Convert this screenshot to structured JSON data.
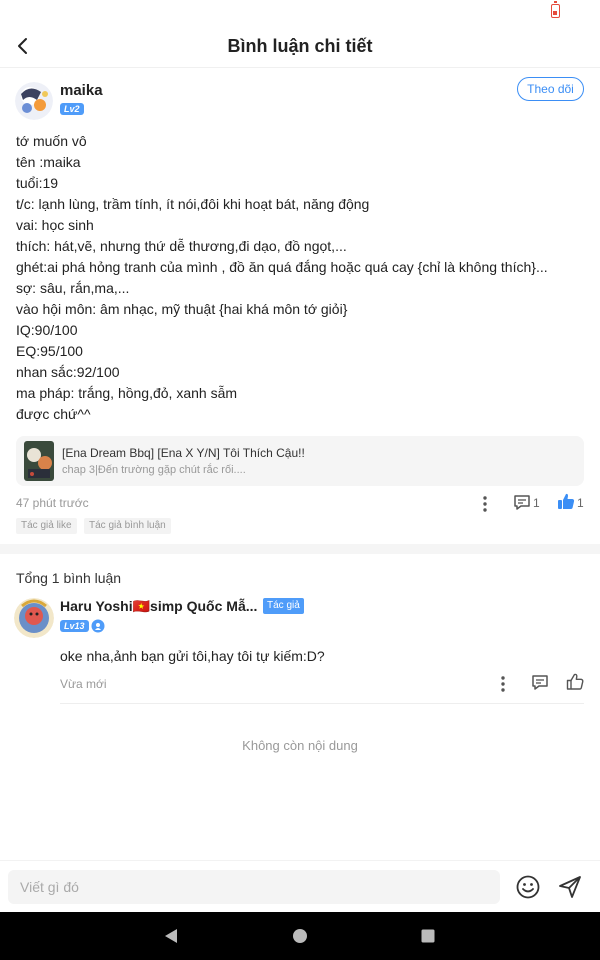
{
  "header": {
    "title": "Bình luận chi tiết"
  },
  "post": {
    "author": "maika",
    "level": "Lv2",
    "follow_label": "Theo dõi",
    "lines": [
      "tớ muốn vô",
      "tên :maika",
      "tuổi:19",
      "t/c: lạnh lùng, trầm tính, ít nói,đôi khi hoạt bát, năng động",
      "vai: học sinh",
      "thích: hát,vẽ, nhưng thứ dễ thương,đi dạo, đồ ngọt,...",
      "ghét:ai phá hỏng tranh của mình , đồ ăn quá đắng hoặc quá cay {chỉ là không thích}...",
      "sợ: sâu, rắn,ma,...",
      "vào hội môn: âm nhạc, mỹ thuật {hai khá môn tớ giỏi}",
      "IQ:90/100",
      "EQ:95/100",
      "nhan sắc:92/100",
      "ma pháp: trắng, hồng,đỏ, xanh sẫm",
      "được chứ^^"
    ],
    "linked": {
      "title": "[Ena Dream Bbq] [Ena X Y/N] Tôi Thích Cậu!!",
      "subtitle": "chap 3|Đến trường gặp chút rắc rối...."
    },
    "time": "47 phút trước",
    "comment_count": "1",
    "like_count": "1",
    "tags": [
      "Tác giả like",
      "Tác giả bình luận"
    ]
  },
  "comments": {
    "total_label": "Tổng 1 bình luận",
    "items": [
      {
        "author": "Haru Yoshi🇻🇳simp Quốc Mẫ...",
        "author_tag": "Tác giả",
        "level": "Lv13",
        "text": "oke nha,ảnh bạn gửi tôi,hay tôi tự kiếm:D?",
        "time": "Vừa mới"
      }
    ],
    "end_text": "Không còn nội dung"
  },
  "composer": {
    "placeholder": "Viết gì đó"
  },
  "colors": {
    "accent": "#3b8ef5",
    "badge": "#4f9cf9",
    "battery": "#e54b3c"
  },
  "icons": [
    "back-arrow-icon",
    "more-icon",
    "comment-icon",
    "thumbs-up-icon",
    "emoji-icon",
    "send-icon",
    "nav-back-icon",
    "nav-home-icon",
    "nav-recents-icon",
    "battery-icon",
    "verified-icon"
  ]
}
